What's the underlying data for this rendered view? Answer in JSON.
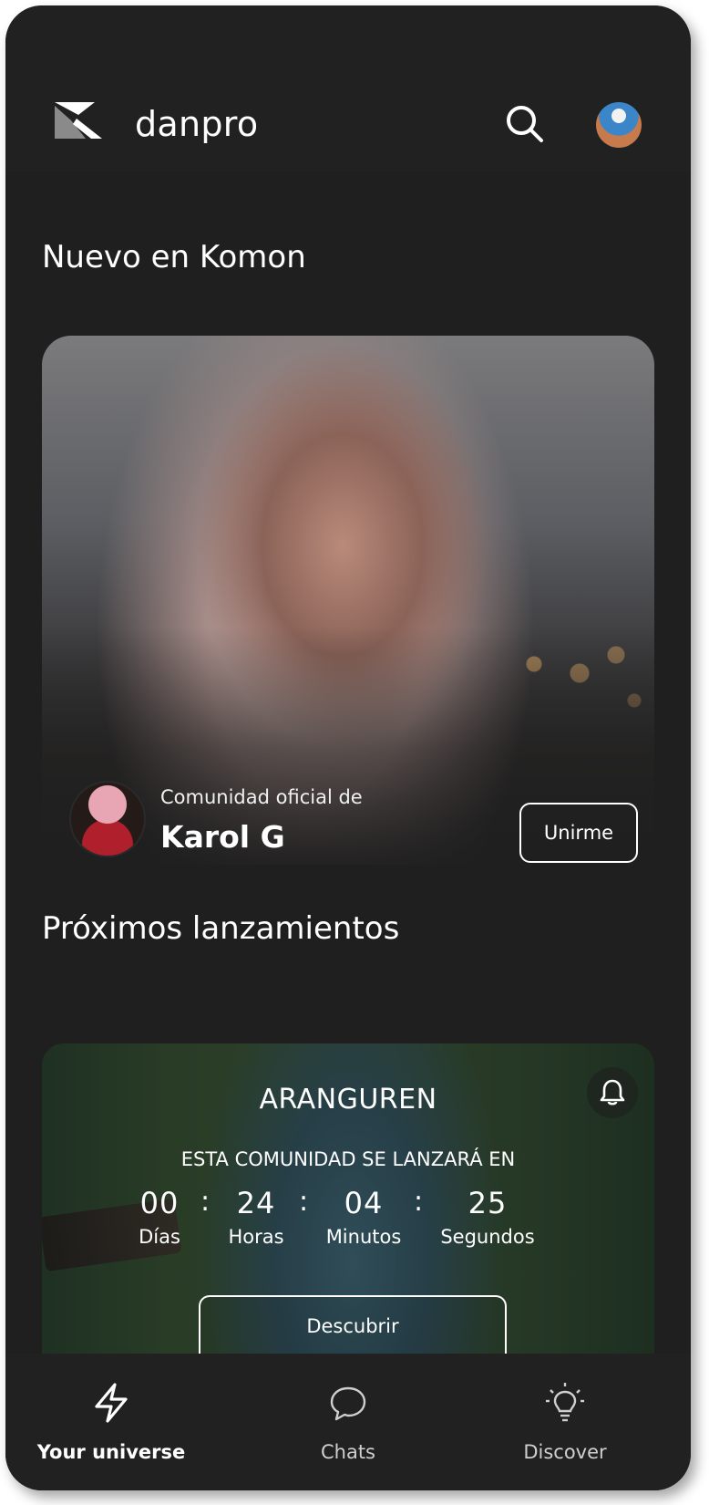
{
  "header": {
    "brand": "danpro",
    "logo_icon": "kaleidoscope-logo-icon",
    "search_icon": "search-icon",
    "avatar": "user-avatar"
  },
  "section_new": {
    "title": "Nuevo en Komon",
    "card": {
      "subtitle": "Comunidad oficial de",
      "name": "Karol G",
      "join_label": "Unirme"
    }
  },
  "section_upcoming": {
    "title": "Próximos lanzamientos",
    "card": {
      "artist": "ARANGUREN",
      "launch_note": "ESTA COMUNIDAD SE LANZARÁ EN",
      "countdown": [
        {
          "value": "00",
          "label": "Días"
        },
        {
          "value": "24",
          "label": "Horas"
        },
        {
          "value": "04",
          "label": "Minutos"
        },
        {
          "value": "25",
          "label": "Segundos"
        }
      ],
      "separator": ":",
      "discover_label": "Descubrir",
      "bell_icon": "bell-icon"
    }
  },
  "bottom_nav": {
    "items": [
      {
        "label": "Your universe",
        "icon": "lightning-icon",
        "active": true
      },
      {
        "label": "Chats",
        "icon": "chat-bubble-icon",
        "active": false
      },
      {
        "label": "Discover",
        "icon": "lightbulb-icon",
        "active": false
      }
    ]
  },
  "colors": {
    "background": "#1f1f1f",
    "header": "#212121",
    "text": "#ffffff"
  }
}
